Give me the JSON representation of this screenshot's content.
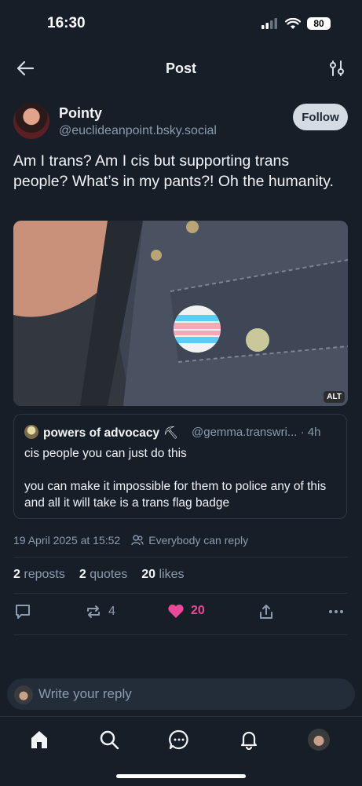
{
  "status": {
    "time": "16:30",
    "battery": "80"
  },
  "header": {
    "title": "Post"
  },
  "author": {
    "name": "Pointy",
    "handle": "@euclideanpoint.bsky.social",
    "follow_label": "Follow"
  },
  "post": {
    "text": "Am I trans? Am I cis but supporting trans people? What’s in my pants?! Oh the humanity.",
    "image_alt_badge": "ALT"
  },
  "quote": {
    "name": "powers of advocacy",
    "handle": "@gemma.transwri...",
    "time": "· 4h",
    "text": "cis people you can just do this\n\nyou can make it impossible for them to police any of this and all it will take is a trans flag badge"
  },
  "meta": {
    "date": "19 April 2025 at 15:52",
    "reply_setting": "Everybody can reply"
  },
  "stats": {
    "reposts_count": "2",
    "reposts_label": "reposts",
    "quotes_count": "2",
    "quotes_label": "quotes",
    "likes_count": "20",
    "likes_label": "likes"
  },
  "actions": {
    "repost_count": "4",
    "like_count": "20"
  },
  "reply": {
    "placeholder": "Write your reply"
  },
  "colors": {
    "background": "#161e27",
    "accent_like": "#ec4899",
    "muted": "#8c9bb0"
  },
  "icons": [
    "back-arrow-icon",
    "filter-icon",
    "repost-icon",
    "heart-icon",
    "share-icon",
    "home-icon",
    "search-icon",
    "chat-icon",
    "bell-icon"
  ]
}
